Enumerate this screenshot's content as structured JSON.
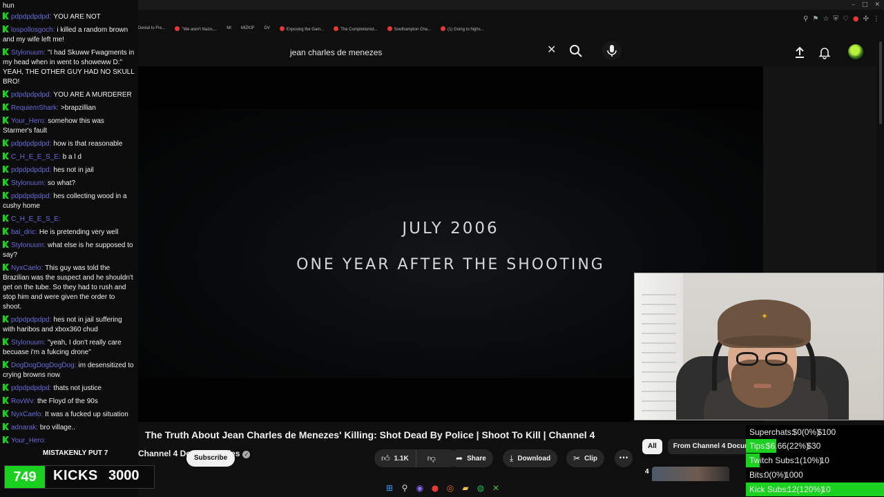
{
  "browser": {
    "bookmarks": [
      "Denial to Fre...",
      "\"We aren't Nazis,...",
      "MI",
      "MIZKIF",
      "DV",
      "Exposing the Gam...",
      "The Completionist...",
      "Southampton Cha...",
      "(1) Going to highs..."
    ]
  },
  "youtube": {
    "search_query": "jean charles de menezes",
    "video": {
      "caption_line1": "JULY 2006",
      "caption_line2": "ONE YEAR AFTER THE SHOOTING",
      "title": "The Truth About Jean Charles de Menezes' Killing: Shot Dead By Police | Shoot To Kill | Channel 4",
      "channel": "Channel 4 Documentaries",
      "subscribe_label": "Subscribe",
      "like_count": "1.1K",
      "share_label": "Share",
      "download_label": "Download",
      "clip_label": "Clip",
      "more_label": "···"
    },
    "chips": [
      "All",
      "From Channel 4 Docum"
    ],
    "rec_number": "4"
  },
  "stats": [
    {
      "label": "Superchats:",
      "value": "$0(0%)",
      "goal": "$100",
      "fill": 0.0
    },
    {
      "label": "Tips:",
      "value": "$6.66(22%)",
      "goal": "$30",
      "fill": 0.22
    },
    {
      "label": "Twitch Subs:",
      "value": "1(10%)",
      "goal": "10",
      "fill": 0.1
    },
    {
      "label": "Bits:",
      "value": "0(0%)",
      "goal": "1000",
      "fill": 0.0
    },
    {
      "label": "Kick Subs:",
      "value": "12(120%)",
      "goal": "10",
      "fill": 1.0
    }
  ],
  "chat": {
    "first_line": "hun",
    "messages": [
      {
        "user": "pdpdpdpdpd:",
        "text": "YOU ARE NOT"
      },
      {
        "user": "lospollosgoch:",
        "text": "i killed a random brown and my wife left me!"
      },
      {
        "user": "Stylonuum:",
        "text": "\"I had Skuww Fwagments in my head when in went to showeww D:\" YEAH, THE OTHER GUY HAD NO SKULL BRO!"
      },
      {
        "user": "pdpdpdpdpd:",
        "text": "YOU ARE A MURDERER"
      },
      {
        "user": "RequiemShark:",
        "text": ">brapzillian"
      },
      {
        "user": "Your_Hero:",
        "text": "somehow this was Starmer's fault"
      },
      {
        "user": "pdpdpdpdpd:",
        "text": "how is that reasonable"
      },
      {
        "user": "C_H_E_E_S_E:",
        "text": "b a l d"
      },
      {
        "user": "pdpdpdpdpd:",
        "text": "hes not in jail"
      },
      {
        "user": "Stylonuum:",
        "text": "so what?"
      },
      {
        "user": "pdpdpdpdpd:",
        "text": "hes collecting wood in a cushy home"
      },
      {
        "user": "C_H_E_E_S_E:",
        "text": ""
      },
      {
        "user": "bal_dric:",
        "text": "He is pretending very well"
      },
      {
        "user": "Stylonuum:",
        "text": "what else is he supposed to say?"
      },
      {
        "user": "NyxCaelo:",
        "text": "This guy was told the Brazilian was the suspect and he shouldn't get on the tube. So they had to rush and stop him and were given the order to shoot."
      },
      {
        "user": "pdpdpdpdpd:",
        "text": "hes not in jail suffering with haribos and xbox360 chud"
      },
      {
        "user": "Stylonuum:",
        "text": "\"yeah, I don't really care becuase i'm a fukcing drone\""
      },
      {
        "user": "DogDogDogDogDog:",
        "text": "im desensitized to crying browns now"
      },
      {
        "user": "pdpdpdpdpd:",
        "text": "thats not justice"
      },
      {
        "user": "RovWv:",
        "text": "the Floyd of the 90s"
      },
      {
        "user": "NyxCaelo:",
        "text": "It was a fucked up situation"
      },
      {
        "user": "adnarak:",
        "text": "bro village.."
      },
      {
        "user": "Your_Hero:",
        "text": ""
      }
    ],
    "alert": "MISTAKENLY PUT 7",
    "kicks_count": "749",
    "kicks_label": "KICKS",
    "kicks_goal": "3000"
  }
}
